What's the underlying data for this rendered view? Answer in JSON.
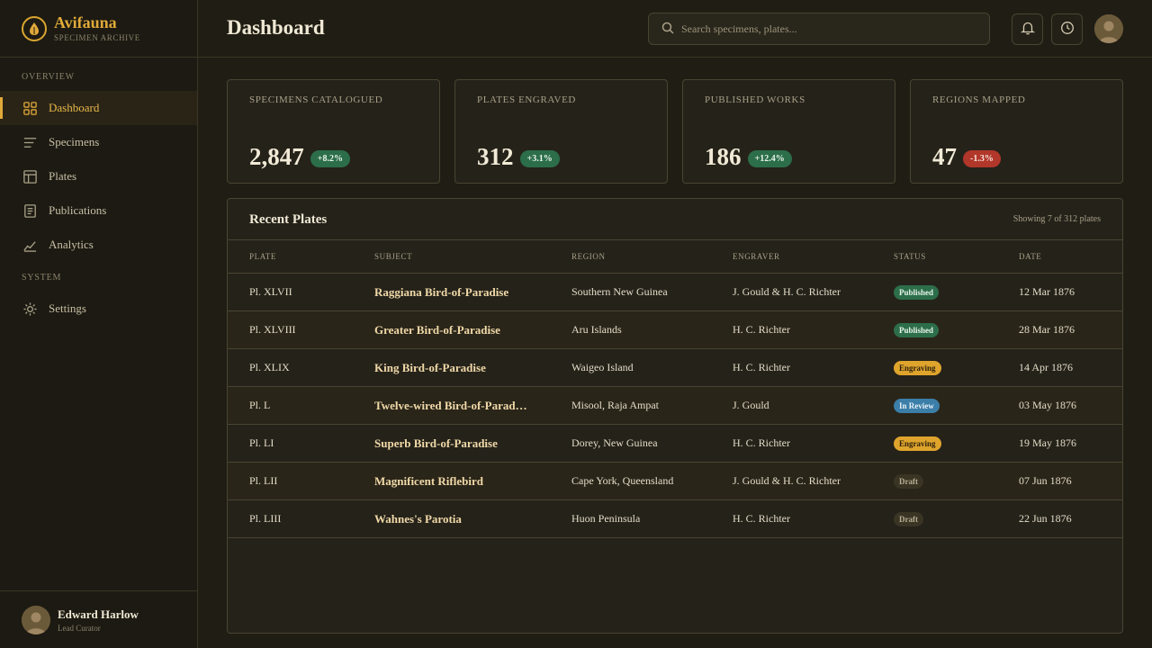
{
  "brand": {
    "name": "Avifauna",
    "subtitle": "SPECIMEN ARCHIVE"
  },
  "nav": {
    "overview_label": "OVERVIEW",
    "system_label": "SYSTEM",
    "items": [
      {
        "label": "Dashboard",
        "icon": "grid-icon",
        "active": true
      },
      {
        "label": "Specimens",
        "icon": "list-icon",
        "active": false
      },
      {
        "label": "Plates",
        "icon": "layout-icon",
        "active": false
      },
      {
        "label": "Publications",
        "icon": "document-icon",
        "active": false
      },
      {
        "label": "Analytics",
        "icon": "chart-line-icon",
        "active": false
      }
    ],
    "settings_label": "Settings"
  },
  "user": {
    "name": "Edward Harlow",
    "role": "Lead Curator"
  },
  "header": {
    "title": "Dashboard",
    "search_placeholder": "Search specimens, plates..."
  },
  "stats": [
    {
      "label": "SPECIMENS CATALOGUED",
      "value": "2,847",
      "delta": "+8.2%",
      "trend": "up"
    },
    {
      "label": "PLATES ENGRAVED",
      "value": "312",
      "delta": "+3.1%",
      "trend": "up"
    },
    {
      "label": "PUBLISHED WORKS",
      "value": "186",
      "delta": "+12.4%",
      "trend": "up"
    },
    {
      "label": "REGIONS MAPPED",
      "value": "47",
      "delta": "-1.3%",
      "trend": "down"
    }
  ],
  "table": {
    "title": "Recent Plates",
    "count_text": "Showing 7 of 312 plates",
    "columns": [
      "PLATE",
      "SUBJECT",
      "REGION",
      "ENGRAVER",
      "STATUS",
      "DATE"
    ],
    "rows": [
      {
        "plate": "Pl. XLVII",
        "subject": "Raggiana Bird-of-Paradise",
        "region": "Southern New Guinea",
        "engraver": "J. Gould & H. C. Richter",
        "status": "Published",
        "status_kind": "published",
        "date": "12 Mar 1876"
      },
      {
        "plate": "Pl. XLVIII",
        "subject": "Greater Bird-of-Paradise",
        "region": "Aru Islands",
        "engraver": "H. C. Richter",
        "status": "Published",
        "status_kind": "published",
        "date": "28 Mar 1876"
      },
      {
        "plate": "Pl. XLIX",
        "subject": "King Bird-of-Paradise",
        "region": "Waigeo Island",
        "engraver": "H. C. Richter",
        "status": "Engraving",
        "status_kind": "engraving",
        "date": "14 Apr 1876"
      },
      {
        "plate": "Pl. L",
        "subject": "Twelve-wired Bird-of-Parad…",
        "region": "Misool, Raja Ampat",
        "engraver": "J. Gould",
        "status": "In Review",
        "status_kind": "review",
        "date": "03 May 1876"
      },
      {
        "plate": "Pl. LI",
        "subject": "Superb Bird-of-Paradise",
        "region": "Dorey, New Guinea",
        "engraver": "H. C. Richter",
        "status": "Engraving",
        "status_kind": "engraving",
        "date": "19 May 1876"
      },
      {
        "plate": "Pl. LII",
        "subject": "Magnificent Riflebird",
        "region": "Cape York, Queensland",
        "engraver": "J. Gould & H. C. Richter",
        "status": "Draft",
        "status_kind": "draft",
        "date": "07 Jun 1876"
      },
      {
        "plate": "Pl. LIII",
        "subject": "Wahnes's Parotia",
        "region": "Huon Peninsula",
        "engraver": "H. C. Richter",
        "status": "Draft",
        "status_kind": "draft",
        "date": "22 Jun 1876"
      }
    ]
  },
  "colors": {
    "accent": "#e0a93a",
    "background": "#201d14",
    "published": "#2c6e4a",
    "engraving": "#dfa42c",
    "review": "#3b7ea8",
    "negative": "#b1372a"
  }
}
